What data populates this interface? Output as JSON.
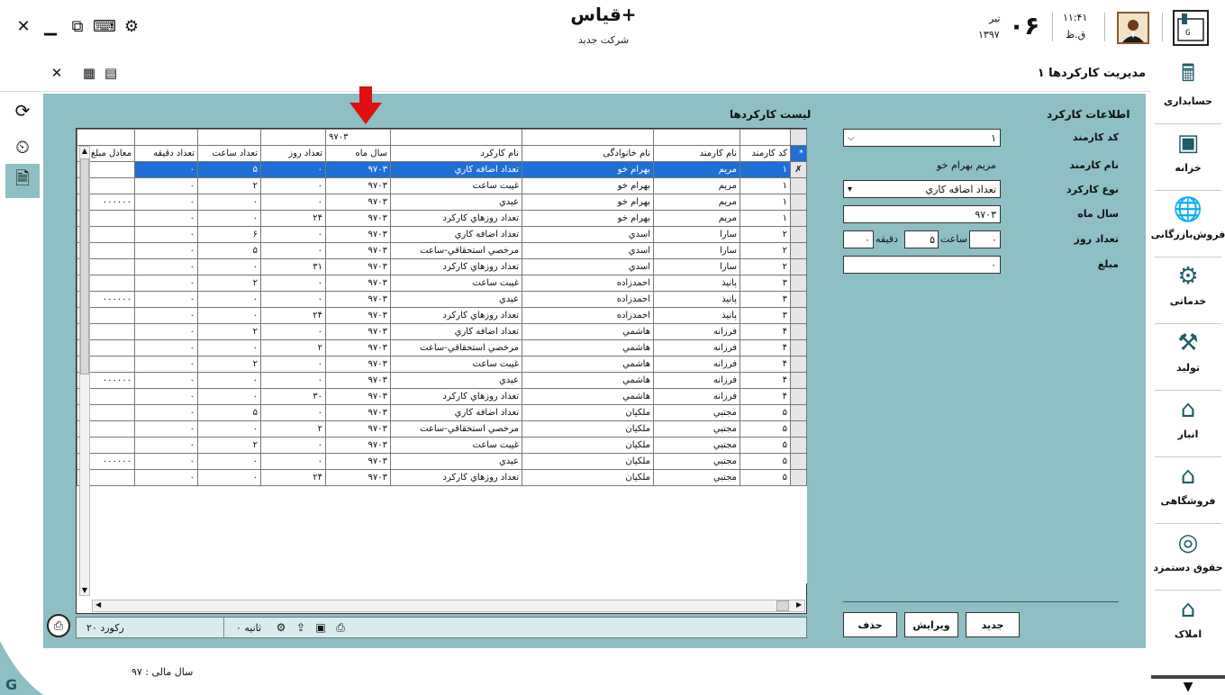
{
  "app": {
    "title": "قیاس+",
    "company": "شرکت جدید"
  },
  "clock": {
    "day": "۰۶",
    "month": "تیر",
    "year": "۱۳۹۷",
    "time": "۱۱:۴۱",
    "ampm": "ق.ظ"
  },
  "window": {
    "close": "✕",
    "minimize": "▁",
    "restore": "⧉",
    "keyboard": "⌨",
    "settings": "⚙"
  },
  "page": {
    "heading": "مدیریت کارکردها"
  },
  "sidebar": {
    "items": [
      {
        "label": "حسابداری",
        "icon": "accounting-icon"
      },
      {
        "label": "خزانه",
        "icon": "safe-icon"
      },
      {
        "label": "فروش‌بازرگانی",
        "icon": "globe-trade-icon"
      },
      {
        "label": "خدماتی",
        "icon": "gear-services-icon"
      },
      {
        "label": "تولید",
        "icon": "production-icon"
      },
      {
        "label": "انبار",
        "icon": "warehouse-icon"
      },
      {
        "label": "فروشگاهی",
        "icon": "shop-icon"
      },
      {
        "label": "حقوق دستمزد",
        "icon": "coins-icon"
      },
      {
        "label": "املاک",
        "icon": "house-icon"
      }
    ]
  },
  "form": {
    "title": "اطلاعات کارکرد",
    "employee_code_label": "کد کارمند",
    "employee_code_value": "۱",
    "employee_name_label": "نام کارمند",
    "employee_name_value": "مریم بهرام خو",
    "work_type_label": "نوع کارکرد",
    "work_type_value": "تعداد اضافه کاري",
    "year_month_label": "سال ماه",
    "year_month_value": "۹۷۰۳",
    "days_label": "تعداد روز",
    "days_value": "۰",
    "hour_label": "ساعت",
    "hour_value": "۵",
    "minute_label": "دقیقه",
    "minute_value": "۰",
    "amount_label": "مبلغ",
    "amount_value": "۰",
    "buttons": {
      "new": "جدید",
      "edit": "ویرایش",
      "delete": "حذف"
    }
  },
  "grid": {
    "title": "لیست کارکردها",
    "filter_value": "۹۷۰۳",
    "columns": [
      "کد کارمند",
      "نام کارمند",
      "نام خانوادگی",
      "نام کارکرد",
      "سال ماه",
      "تعداد روز",
      "تعداد ساعت",
      "تعداد دقیقه",
      "معادل مبلغ"
    ],
    "rows": [
      [
        "۱",
        "مریم",
        "بهرام خو",
        "تعداد اضافه کاري",
        "۹۷۰۳",
        "۰",
        "۵",
        "۰",
        ""
      ],
      [
        "۱",
        "مریم",
        "بهرام خو",
        "غیبت ساعت",
        "۹۷۰۳",
        "۰",
        "۲",
        "۰",
        ""
      ],
      [
        "۱",
        "مریم",
        "بهرام خو",
        "عیدي",
        "۹۷۰۳",
        "۰",
        "۰",
        "۰",
        "۰۰۰۰۰۰"
      ],
      [
        "۱",
        "مریم",
        "بهرام خو",
        "تعداد روزهاي کارکرد",
        "۹۷۰۳",
        "۲۴",
        "۰",
        "۰",
        ""
      ],
      [
        "۲",
        "سارا",
        "اسدي",
        "تعداد اضافه کاري",
        "۹۷۰۳",
        "۰",
        "۶",
        "۰",
        ""
      ],
      [
        "۲",
        "سارا",
        "اسدي",
        "مرخصي استحقاقي-ساعت",
        "۹۷۰۳",
        "۰",
        "۵",
        "۰",
        ""
      ],
      [
        "۲",
        "سارا",
        "اسدي",
        "تعداد روزهاي کارکرد",
        "۹۷۰۳",
        "۳۱",
        "۰",
        "۰",
        ""
      ],
      [
        "۳",
        "پانیذ",
        "احمدزاده",
        "غیبت ساعت",
        "۹۷۰۳",
        "۰",
        "۲",
        "۰",
        ""
      ],
      [
        "۳",
        "پانیذ",
        "احمدزاده",
        "عیدي",
        "۹۷۰۳",
        "۰",
        "۰",
        "۰",
        "۰۰۰۰۰۰"
      ],
      [
        "۳",
        "پانیذ",
        "احمدزاده",
        "تعداد روزهاي کارکرد",
        "۹۷۰۳",
        "۲۴",
        "۰",
        "۰",
        ""
      ],
      [
        "۴",
        "فرزانه",
        "هاشمي",
        "تعداد اضافه کاري",
        "۹۷۰۳",
        "۰",
        "۲",
        "۰",
        ""
      ],
      [
        "۴",
        "فرزانه",
        "هاشمي",
        "مرخصي استحقاقي-ساعت",
        "۹۷۰۳",
        "۲",
        "۰",
        "۰",
        ""
      ],
      [
        "۴",
        "فرزانه",
        "هاشمي",
        "غیبت ساعت",
        "۹۷۰۳",
        "۰",
        "۲",
        "۰",
        ""
      ],
      [
        "۴",
        "فرزانه",
        "هاشمي",
        "عیدي",
        "۹۷۰۳",
        "۰",
        "۰",
        "۰",
        "۰۰۰۰۰۰"
      ],
      [
        "۴",
        "فرزانه",
        "هاشمي",
        "تعداد روزهاي کارکرد",
        "۹۷۰۳",
        "۳۰",
        "۰",
        "۰",
        ""
      ],
      [
        "۵",
        "مجتبي",
        "ملکیان",
        "تعداد اضافه کاري",
        "۹۷۰۳",
        "۰",
        "۵",
        "۰",
        ""
      ],
      [
        "۵",
        "مجتبي",
        "ملکیان",
        "مرخصي استحقاقي-ساعت",
        "۹۷۰۳",
        "۲",
        "۰",
        "۰",
        ""
      ],
      [
        "۵",
        "مجتبي",
        "ملکیان",
        "غیبت ساعت",
        "۹۷۰۳",
        "۰",
        "۲",
        "۰",
        ""
      ],
      [
        "۵",
        "مجتبي",
        "ملکیان",
        "عیدي",
        "۹۷۰۳",
        "۰",
        "۰",
        "۰",
        "۰۰۰۰۰۰"
      ],
      [
        "۵",
        "مجتبي",
        "ملکیان",
        "تعداد روزهاي کارکرد",
        "۹۷۰۳",
        "۲۴",
        "۰",
        "۰",
        ""
      ]
    ],
    "record_count": "۲۰ رکورد",
    "seconds": "۰ ثانیه"
  },
  "footer": {
    "fiscal_year": "سال مالی : ۹۷"
  },
  "colors": {
    "panel": "#8dbfc4",
    "selection": "#1f6fd6",
    "arrow": "#e01010"
  }
}
